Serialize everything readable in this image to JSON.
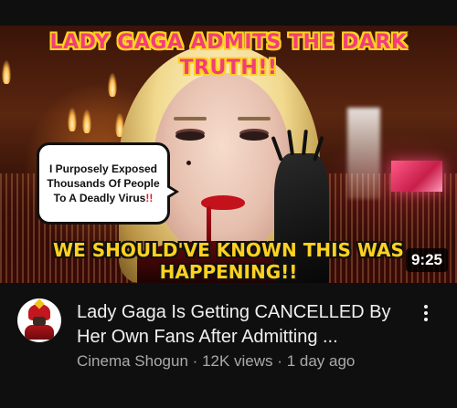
{
  "thumbnail": {
    "headline_line1": "LADY GAGA ADMITS THE DARK",
    "headline_line2": "TRUTH!!",
    "bubble_text": "I Purposely Exposed Thousands Of People To A Deadly Virus",
    "bubble_bang": "!!",
    "subhead_line1": "WE SHOULD'VE KNOWN THIS WAS",
    "subhead_line2": "HAPPENING!!",
    "duration": "9:25",
    "colors": {
      "headline": "#f23d7a",
      "headline_outline": "#ffd21f",
      "subhead": "#ffd21f",
      "lips": "#c4121c"
    }
  },
  "video": {
    "title": "Lady Gaga Is Getting CANCELLED By Her Own Fans After Admitting ...",
    "channel": "Cinema Shogun",
    "views": "12K views",
    "age": "1 day ago",
    "separator": "·"
  },
  "icons": {
    "channel_avatar": "samurai-avatar-icon",
    "menu": "more-vertical-icon"
  }
}
